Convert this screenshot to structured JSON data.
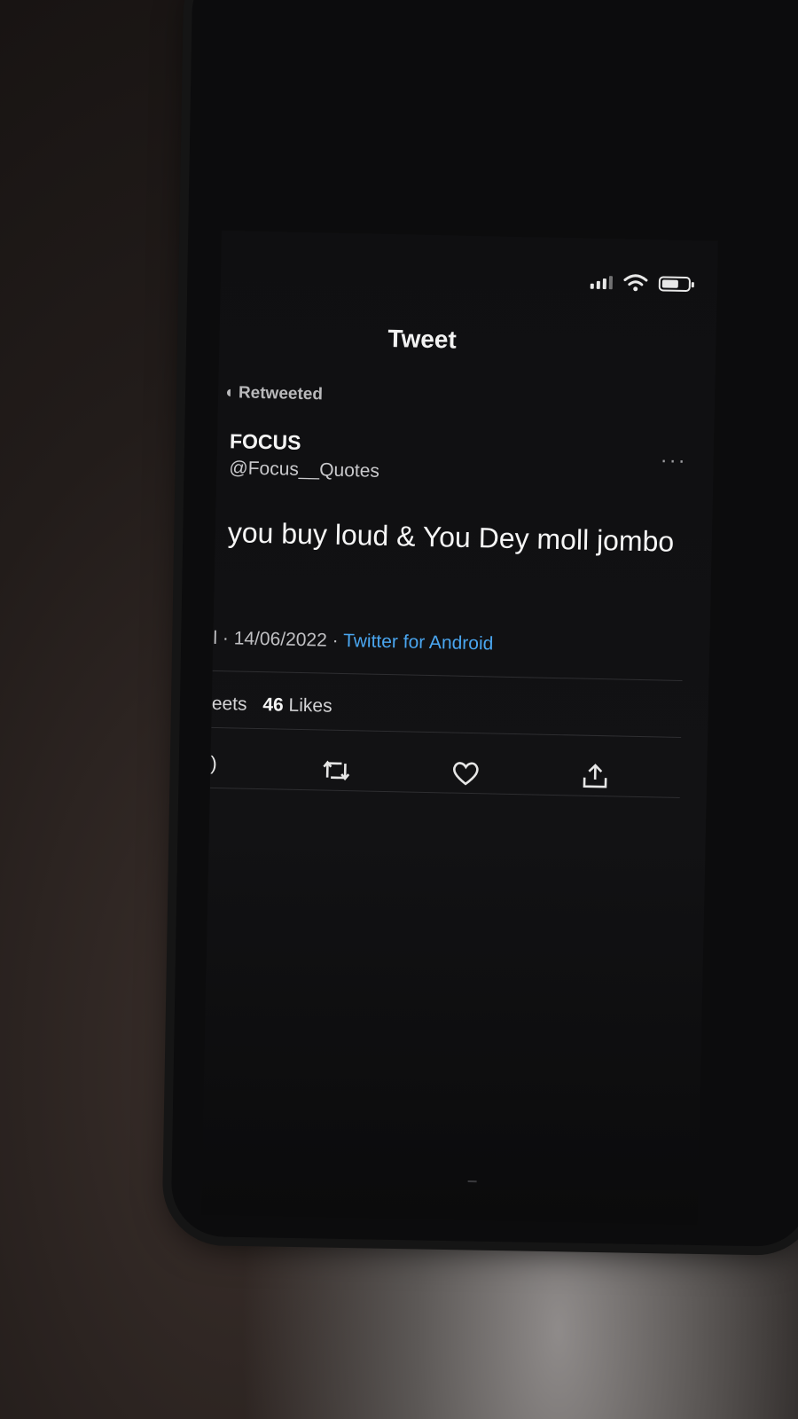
{
  "screen": {
    "title": "Tweet",
    "retweet_label": "Retweeted",
    "author": {
      "name": "FOCUS",
      "handle": "@Focus__Quotes"
    },
    "tweet_text": "you buy loud & You Dey moll jombo",
    "meta": {
      "time_fragment": "l ·",
      "date": "14/06/2022",
      "separator": "·",
      "source": "Twitter for Android"
    },
    "stats": {
      "retweets_fragment": "eets",
      "likes_count": "46",
      "likes_label": "Likes"
    },
    "actions": {
      "reply_fragment": ")"
    },
    "more_label": "···"
  },
  "icons": {
    "retweet": "retweet-icon",
    "like": "heart-icon",
    "share": "share-icon",
    "signal": "signal-icon",
    "wifi": "wifi-icon",
    "battery": "battery-icon"
  },
  "colors": {
    "link": "#4aa6f0",
    "background": "#121214",
    "text": "#f4f4f4"
  }
}
